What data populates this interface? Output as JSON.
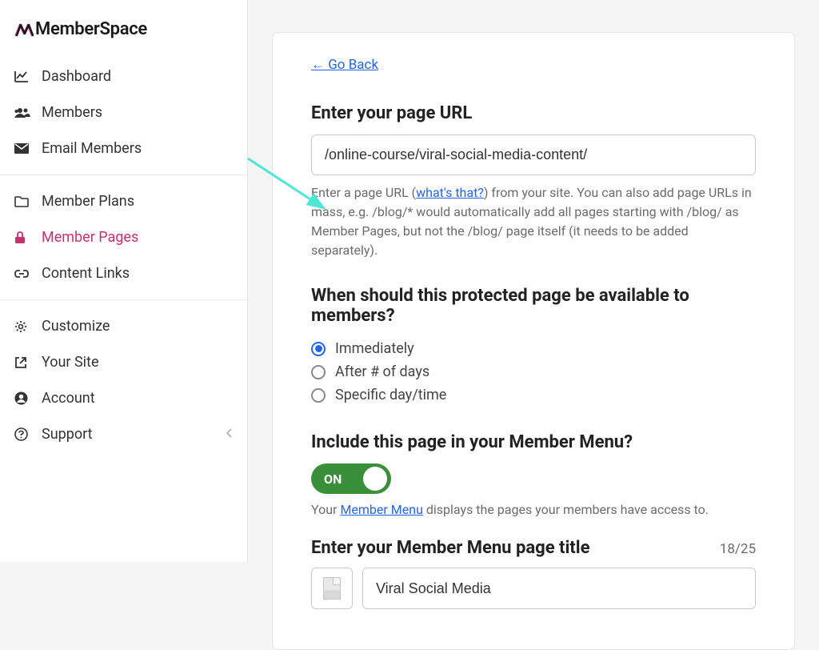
{
  "logo": "MemberSpace",
  "sidebar": {
    "group1": [
      {
        "icon": "chart-line",
        "label": "Dashboard",
        "active": false
      },
      {
        "icon": "users",
        "label": "Members",
        "active": false
      },
      {
        "icon": "envelope",
        "label": "Email Members",
        "active": false
      }
    ],
    "group2": [
      {
        "icon": "folder",
        "label": "Member Plans",
        "active": false
      },
      {
        "icon": "lock",
        "label": "Member Pages",
        "active": true
      },
      {
        "icon": "link",
        "label": "Content Links",
        "active": false
      }
    ],
    "group3": [
      {
        "icon": "gear",
        "label": "Customize",
        "active": false
      },
      {
        "icon": "external",
        "label": "Your Site",
        "active": false
      },
      {
        "icon": "user-circle",
        "label": "Account",
        "active": false
      },
      {
        "icon": "help",
        "label": "Support",
        "active": false
      }
    ]
  },
  "main": {
    "go_back": "← Go Back",
    "url_section": {
      "label": "Enter your page URL",
      "value": "/online-course/viral-social-media-content/",
      "help_pre": "Enter a page URL (",
      "help_link": "what's that?",
      "help_post": ") from your site. You can also add page URLs in mass, e.g. /blog/* would automatically add all pages starting with /blog/ as Member Pages, but not the /blog/ page itself (it needs to be added separately)."
    },
    "availability": {
      "label": "When should this protected page be available to members?",
      "options": [
        "Immediately",
        "After # of days",
        "Specific day/time"
      ],
      "selected": 0
    },
    "menu_include": {
      "label": "Include this page in your Member Menu?",
      "toggle_text": "ON",
      "help_pre": "Your ",
      "help_link": "Member Menu",
      "help_post": " displays the pages your members have access to."
    },
    "menu_title": {
      "label": "Enter your Member Menu page title",
      "counter": "18/25",
      "value": "Viral Social Media"
    }
  }
}
